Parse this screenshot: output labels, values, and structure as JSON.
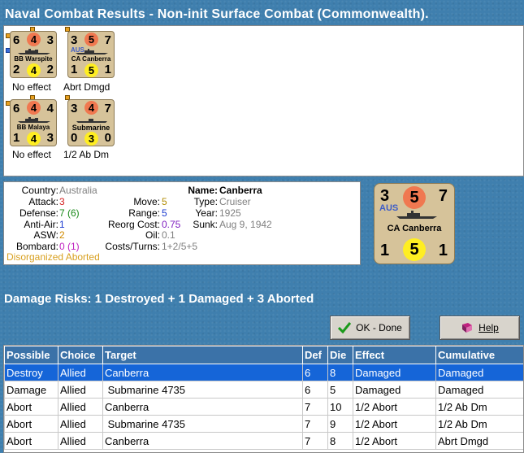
{
  "window": {
    "title": "Naval Combat Results - Non-init Surface Combat (Commonwealth)."
  },
  "units": [
    {
      "top_left": "6",
      "attack": "4",
      "top_right": "3",
      "nationality": "",
      "name": "BB Warspite",
      "bot_left": "2",
      "defense": "4",
      "bot_right": "2",
      "result": "No effect"
    },
    {
      "top_left": "3",
      "attack": "5",
      "top_right": "7",
      "nationality": "AUS",
      "name": "CA Canberra",
      "bot_left": "1",
      "defense": "5",
      "bot_right": "1",
      "result": "Abrt Dmgd"
    },
    {
      "top_left": "6",
      "attack": "4",
      "top_right": "4",
      "nationality": "",
      "name": "BB Malaya",
      "bot_left": "1",
      "defense": "4",
      "bot_right": "3",
      "result": "No effect"
    },
    {
      "top_left": "3",
      "attack": "4",
      "top_right": "7",
      "nationality": "",
      "name": "Submarine",
      "bot_left": "0",
      "defense": "3",
      "bot_right": "0",
      "result": "1/2 Ab Dm"
    }
  ],
  "details": {
    "country_label": "Country:",
    "country": "Australia",
    "attack_label": "Attack:",
    "attack": "3",
    "defense_label": "Defense:",
    "defense": "7 (6)",
    "antiair_label": "Anti-Air:",
    "antiair": "1",
    "asw_label": "ASW:",
    "asw": "2",
    "bombard_label": "Bombard:",
    "bombard": "0 (1)",
    "status": "Disorganized Aborted",
    "move_label": "Move:",
    "move": "5",
    "range_label": "Range:",
    "range": "5",
    "reorg_label": "Reorg Cost:",
    "reorg": "0.75",
    "oil_label": "Oil:",
    "oil": "0.1",
    "costs_label": "Costs/Turns:",
    "costs": "1+2/5+5",
    "name_label": "Name:",
    "name": "Canberra",
    "type_label": "Type:",
    "type": "Cruiser",
    "year_label": "Year:",
    "year": "1925",
    "sunk_label": "Sunk:",
    "sunk": "Aug 9, 1942"
  },
  "big_counter": {
    "top_left": "3",
    "attack": "5",
    "top_right": "7",
    "nationality": "AUS",
    "name": "CA Canberra",
    "bot_left": "1",
    "defense": "5",
    "bot_right": "1"
  },
  "damage_risks": "Damage Risks: 1 Destroyed + 1 Damaged + 3 Aborted",
  "buttons": {
    "ok": "OK - Done",
    "help": "Help"
  },
  "table": {
    "headers": [
      "Possible",
      "Choice",
      "Target",
      "Def",
      "Die",
      "Effect",
      "Cumulative"
    ],
    "rows": [
      [
        "Destroy",
        "Allied",
        "Canberra",
        "6",
        "8",
        "Damaged",
        "Damaged"
      ],
      [
        "Damage",
        "Allied",
        " Submarine 4735",
        "6",
        "5",
        "Damaged",
        "Damaged"
      ],
      [
        "Abort",
        "Allied",
        "Canberra",
        "7",
        "10",
        "1/2 Abort",
        "1/2 Ab Dm"
      ],
      [
        "Abort",
        "Allied",
        " Submarine 4735",
        "7",
        "9",
        "1/2 Abort",
        "1/2 Ab Dm"
      ],
      [
        "Abort",
        "Allied",
        "Canberra",
        "7",
        "8",
        "1/2 Abort",
        "Abrt Dmgd"
      ]
    ]
  },
  "colors": {
    "attack": "#d42020",
    "defense": "#1a8a1a",
    "antiair": "#1a3ad0",
    "asw": "#d08a00",
    "bombard": "#c020c0",
    "status": "#d8a020",
    "muted": "#808080",
    "move": "#b08a00",
    "reorg": "#8020c0",
    "range": "#1a3ad0"
  }
}
